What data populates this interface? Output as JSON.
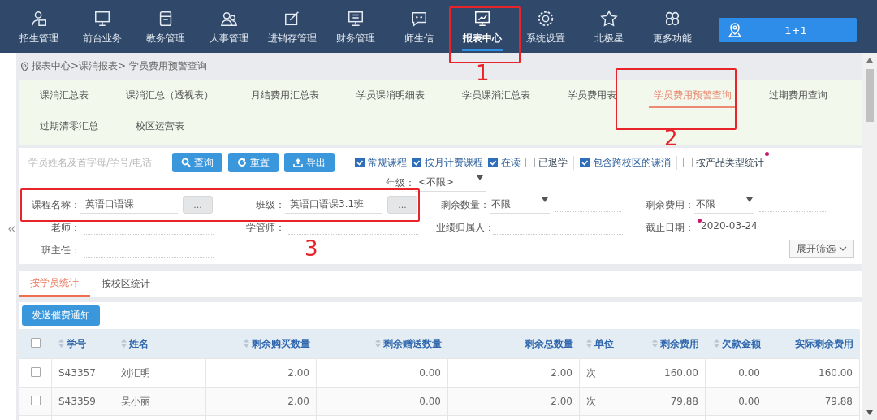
{
  "nav": {
    "items": [
      {
        "label": "招生管理",
        "selected": false
      },
      {
        "label": "前台业务",
        "selected": false
      },
      {
        "label": "教务管理",
        "selected": false
      },
      {
        "label": "人事管理",
        "selected": false
      },
      {
        "label": "进销存管理",
        "selected": false
      },
      {
        "label": "财务管理",
        "selected": false
      },
      {
        "label": "师生信",
        "selected": false
      },
      {
        "label": "报表中心",
        "selected": true
      },
      {
        "label": "系统设置",
        "selected": false
      },
      {
        "label": "北极星",
        "selected": false
      },
      {
        "label": "更多功能",
        "selected": false
      }
    ],
    "location": "1+1"
  },
  "breadcrumb": "报表中心>课消报表> 学员费用预警查询",
  "report_tabs": [
    [
      {
        "label": "课消汇总表",
        "selected": false
      },
      {
        "label": "课消汇总（透视表）",
        "selected": false
      },
      {
        "label": "月结费用汇总表",
        "selected": false
      },
      {
        "label": "学员课消明细表",
        "selected": false
      },
      {
        "label": "学员课消汇总表",
        "selected": false
      },
      {
        "label": "学员费用表",
        "selected": false
      },
      {
        "label": "学员费用预警查询",
        "selected": true
      },
      {
        "label": "过期费用查询",
        "selected": false
      }
    ],
    [
      {
        "label": "过期清零汇总",
        "selected": false
      },
      {
        "label": "校区运营表",
        "selected": false
      }
    ]
  ],
  "filters": {
    "search": {
      "placeholder": "学员姓名及首字母/学号/电话"
    },
    "buttons": [
      {
        "label": "查询",
        "kind": "search"
      },
      {
        "label": "重置",
        "kind": "reset"
      },
      {
        "label": "导出",
        "kind": "export"
      }
    ],
    "check_groups": [
      [
        {
          "label": "常规课程",
          "checked": true
        },
        {
          "label": "按月计费课程",
          "checked": true
        },
        {
          "label": "在读",
          "checked": true
        },
        {
          "label": "已退学",
          "checked": false
        }
      ],
      [
        {
          "label": "包含跨校区的课消",
          "checked": true
        }
      ],
      [
        {
          "label": "按产品类型统计",
          "checked": false,
          "required": true
        }
      ]
    ],
    "grade": {
      "label": "年级：",
      "value": "<不限>"
    },
    "field_rows": [
      [
        {
          "kind": "picker",
          "label": "课程名称：",
          "value": "英语口语课",
          "button": "..."
        },
        {
          "kind": "picker",
          "label": "班级：",
          "value": "英语口语课3.1班",
          "button": "..."
        },
        {
          "kind": "select",
          "label": "剩余数量：",
          "value": "不限"
        },
        {
          "kind": "select",
          "label": "剩余费用：",
          "value": "不限"
        }
      ],
      [
        {
          "kind": "text",
          "label": "老师："
        },
        {
          "kind": "text",
          "label": "学管师："
        },
        {
          "kind": "text",
          "label": "业绩归属人："
        },
        {
          "kind": "date",
          "label": "截止日期：",
          "value": "2020-03-24",
          "required": true
        }
      ],
      [
        {
          "kind": "text",
          "label": "班主任："
        }
      ]
    ],
    "expand": "展开筛选"
  },
  "result_tabs": [
    {
      "label": "按学员统计",
      "selected": true
    },
    {
      "label": "按校区统计",
      "selected": false
    }
  ],
  "send_button": "发送催费通知",
  "table": {
    "all_selected": false,
    "columns": [
      {
        "label": "学号",
        "kind": "text",
        "sortable": true
      },
      {
        "label": "姓名",
        "kind": "text",
        "sortable": true
      },
      {
        "label": "剩余购买数量",
        "kind": "number",
        "sortable": true
      },
      {
        "label": "剩余赠送数量",
        "kind": "number",
        "sortable": true
      },
      {
        "label": "剩余总数量",
        "kind": "number",
        "sortable": false
      },
      {
        "label": "单位",
        "kind": "text",
        "sortable": true
      },
      {
        "label": "剩余费用",
        "kind": "number",
        "sortable": true
      },
      {
        "label": "欠款金额",
        "kind": "number",
        "sortable": true
      },
      {
        "label": "实际剩余费用",
        "kind": "number",
        "sortable": false
      }
    ],
    "rows": [
      {
        "selected": false,
        "cells": [
          "S43357",
          "刘汇明",
          "2.00",
          "0.00",
          "2.00",
          "次",
          "160.00",
          "0.00",
          "160.00"
        ]
      },
      {
        "selected": false,
        "cells": [
          "S43359",
          "吴小丽",
          "2.00",
          "0.00",
          "2.00",
          "次",
          "79.88",
          "0.00",
          "79.88"
        ]
      }
    ]
  },
  "annotations": [
    {
      "label": "1"
    },
    {
      "label": "2"
    },
    {
      "label": "3"
    }
  ]
}
